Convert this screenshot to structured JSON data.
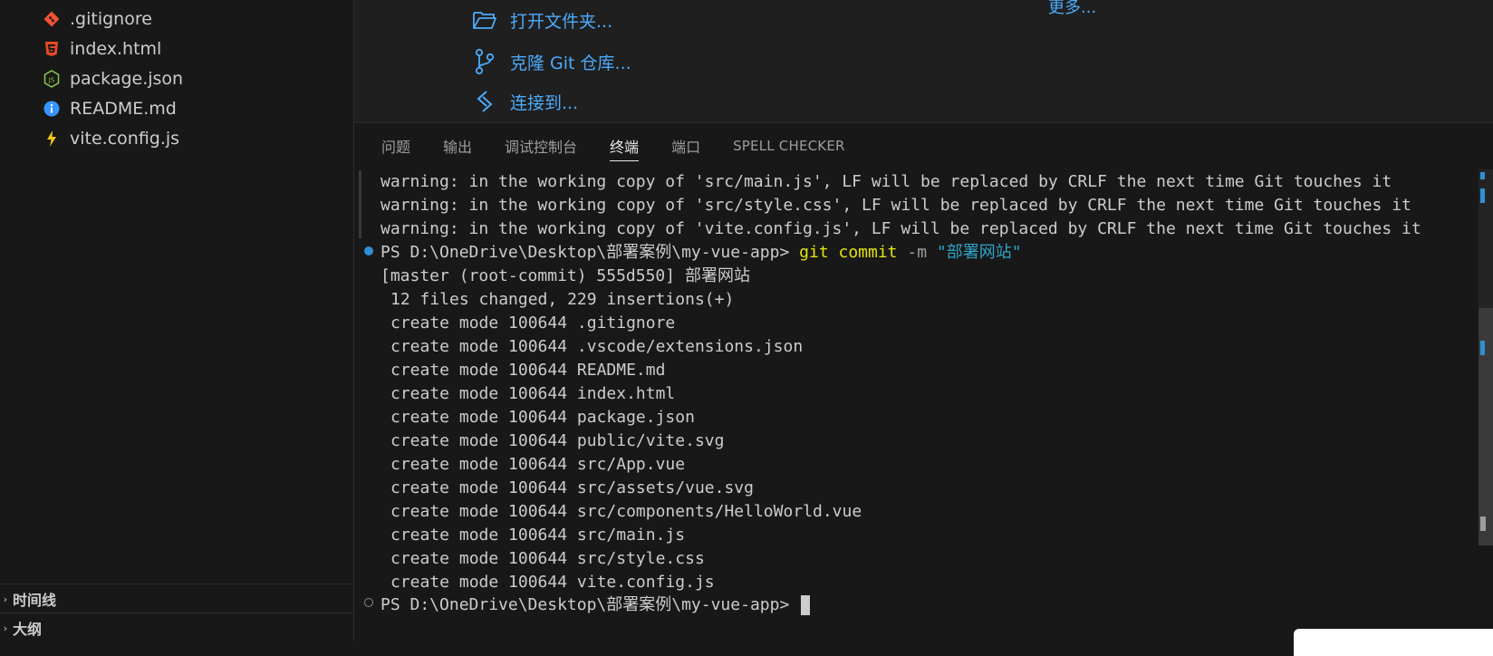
{
  "explorer": {
    "files": [
      {
        "name": ".gitignore",
        "icon": "git-diamond-icon",
        "color": "#f05133"
      },
      {
        "name": "index.html",
        "icon": "html5-icon",
        "color": "#e44d26"
      },
      {
        "name": "package.json",
        "icon": "nodejs-icon",
        "color": "#8cc84b"
      },
      {
        "name": "README.md",
        "icon": "info-icon",
        "color": "#3794ff"
      },
      {
        "name": "vite.config.js",
        "icon": "lightning-icon",
        "color": "#f5c518"
      }
    ],
    "sections": [
      {
        "label": "时间线"
      },
      {
        "label": "大纲"
      }
    ]
  },
  "welcome": {
    "start_items": [
      {
        "label": "打开文件夹...",
        "icon": "folder-open-icon"
      },
      {
        "label": "克隆 Git 仓库...",
        "icon": "source-control-icon"
      },
      {
        "label": "连接到...",
        "icon": "remote-icon"
      }
    ],
    "more_label": "更多..."
  },
  "panel": {
    "tabs": [
      {
        "label": "问题"
      },
      {
        "label": "输出"
      },
      {
        "label": "调试控制台"
      },
      {
        "label": "终端",
        "active": true
      },
      {
        "label": "端口"
      },
      {
        "label": "SPELL CHECKER"
      }
    ]
  },
  "terminal": {
    "warnings": [
      "warning: in the working copy of 'src/main.js', LF will be replaced by CRLF the next time Git touches it",
      "warning: in the working copy of 'src/style.css', LF will be replaced by CRLF the next time Git touches it",
      "warning: in the working copy of 'vite.config.js', LF will be replaced by CRLF the next time Git touches it"
    ],
    "prompt": "PS D:\\OneDrive\\Desktop\\部署案例\\my-vue-app> ",
    "command": {
      "git": "git",
      "sub": "commit",
      "flag": "-m",
      "message": "\"部署网站\""
    },
    "commit_line": "[master (root-commit) 555d550] 部署网站",
    "summary_line": "12 files changed, 229 insertions(+)",
    "create_lines": [
      "create mode 100644 .gitignore",
      "create mode 100644 .vscode/extensions.json",
      "create mode 100644 README.md",
      "create mode 100644 index.html",
      "create mode 100644 package.json",
      "create mode 100644 public/vite.svg",
      "create mode 100644 src/App.vue",
      "create mode 100644 src/assets/vue.svg",
      "create mode 100644 src/components/HelloWorld.vue",
      "create mode 100644 src/main.js",
      "create mode 100644 src/style.css",
      "create mode 100644 vite.config.js"
    ],
    "final_prompt": "PS D:\\OneDrive\\Desktop\\部署案例\\my-vue-app> "
  }
}
